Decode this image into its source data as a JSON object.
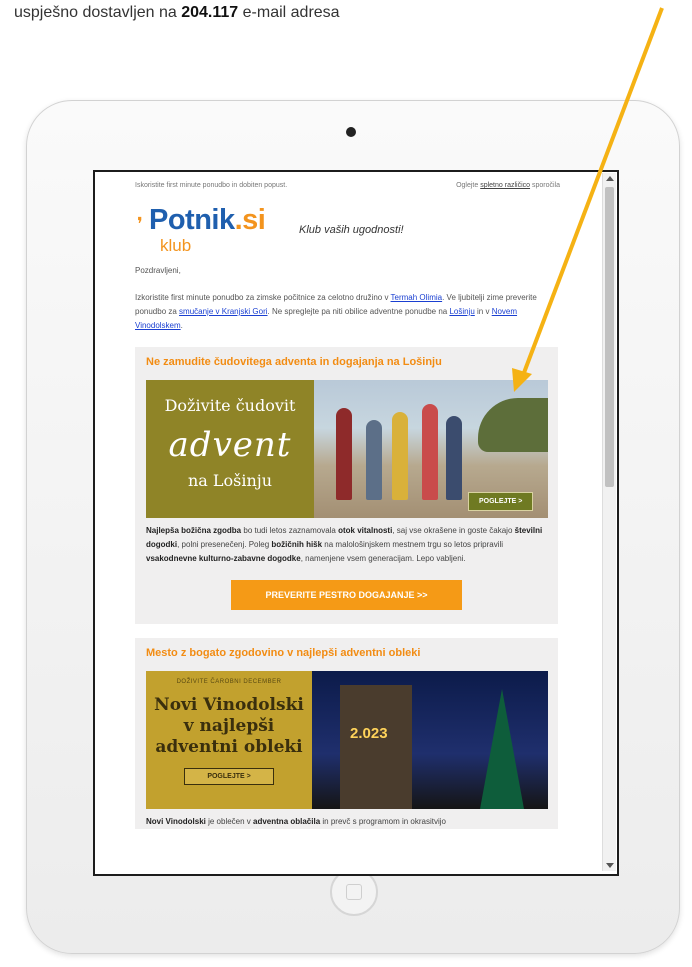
{
  "caption": {
    "text": "uspješno dostavljen na ",
    "count": "204.117",
    "suffix": " e-mail adresa"
  },
  "email": {
    "top_left": "Iskoristite first minute ponudbo in dobiten popust.",
    "top_right_prefix": "Oglejte ",
    "top_right_link": "spletno različico",
    "top_right_suffix": " sporočila",
    "logo_name": "Potnik",
    "logo_tld": ".si",
    "logo_sub": "klub",
    "tagline": "Klub vaših ugodnosti!",
    "greeting": "Pozdravljeni,",
    "intro": {
      "p1": "Izkoristite first minute ponudbo za zimske počitnice za celotno družino v ",
      "link1": "Termah Olimia",
      "p2": ". Ve ljubitelji zime preverite ponudbo za ",
      "link2": "smučanje v Kranjski Gori",
      "p3": ". Ne spreglejte pa niti obilice adventne ponudbe na ",
      "link3": "Lošinju",
      "p4": " in v ",
      "link4": "Novem Vinodolskem",
      "p5": "."
    },
    "card1": {
      "title": "Ne zamudite čudovitega adventa in dogajanja na Lošinju",
      "banner_line1": "Doživite čudovit",
      "banner_line2": "advent",
      "banner_line3": "na Lošinju",
      "banner_button": "POGLEJTE >",
      "body": {
        "b1": "Najlepša božična zgodba",
        "t1": " bo tudi letos zaznamovala ",
        "b2": "otok vitalnosti",
        "t2": ", saj vse okrašene in goste čakajo ",
        "b3": "številni dogodki",
        "t3": ", polni presenečenj. Poleg ",
        "b4": "božičnih hišk",
        "t4": " na malološinjskem mestnem trgu so letos pripravili ",
        "b5": "vsakodnevne kulturno-zabavne dogodke",
        "t5": ", namenjene vsem generacijam. Lepo vabljeni."
      },
      "cta": "PREVERITE PESTRO DOGAJANJE >>"
    },
    "card2": {
      "title": "Mesto z bogato zgodovino v najlepši adventni obleki",
      "banner_small": "DOŽIVITE ČAROBNI DECEMBER",
      "banner_title1": "Novi Vinodolski",
      "banner_title2": "v najlepši",
      "banner_title3": "adventni obleki",
      "banner_button": "POGLEJTE >",
      "sign": "2.023",
      "body": {
        "b1": "Novi Vinodolski",
        "t1": " je oblečen v ",
        "b2": "adventna oblačila",
        "t2": " in prevč s programom in okrasitvijo"
      }
    }
  },
  "colors": {
    "accent": "#f28c13",
    "cta": "#f59a16",
    "brand_blue": "#1f5fae",
    "arrow": "#f5b214"
  }
}
